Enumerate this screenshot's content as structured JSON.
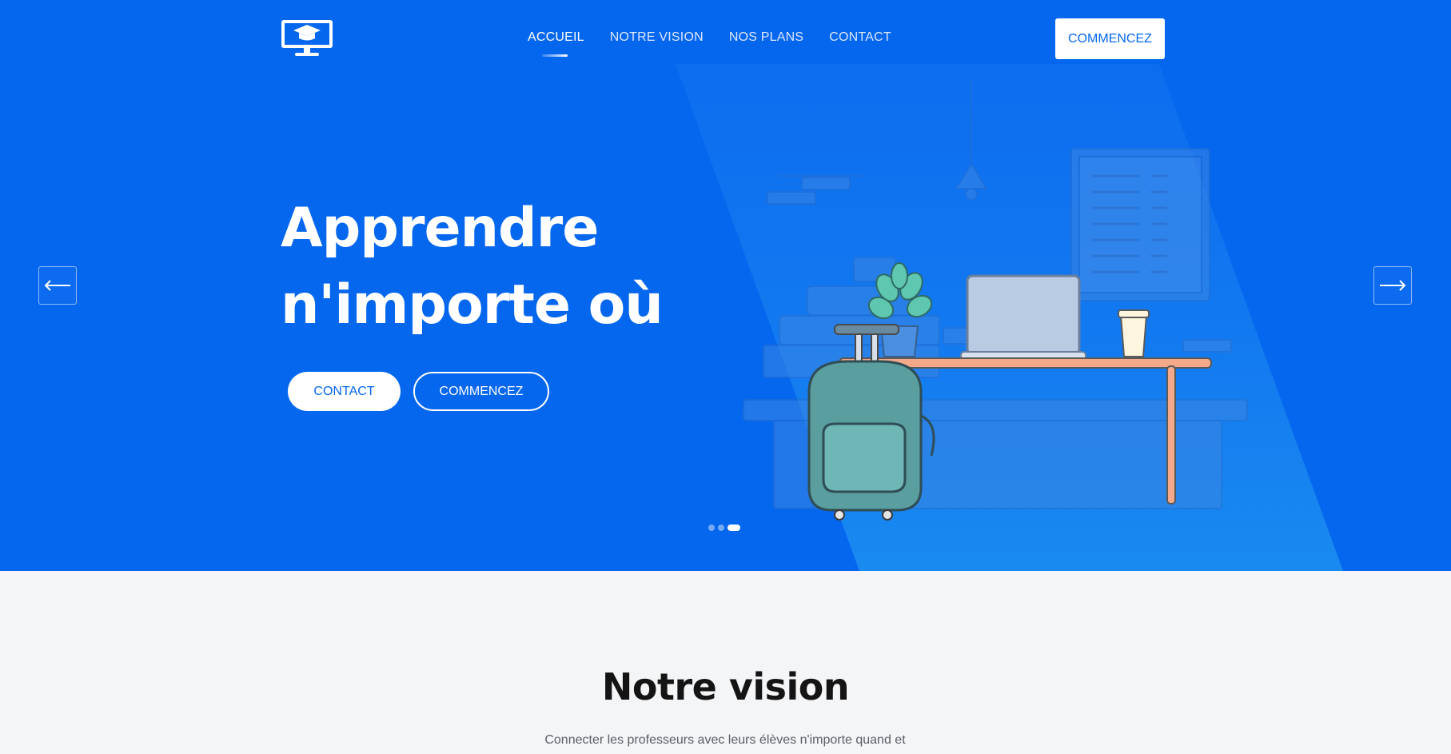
{
  "colors": {
    "hero_bg": "#0567ee",
    "beam": "#1a8cf0",
    "accent": "#0567ee",
    "white": "#ffffff",
    "section_bg": "#f4f5f7",
    "heading_dark": "#141414",
    "body_text": "#5a5f66"
  },
  "header": {
    "logo_icon": "monitor-graduation-cap-icon",
    "nav": [
      {
        "label": "ACCUEIL",
        "active": true
      },
      {
        "label": "NOTRE VISION",
        "active": false
      },
      {
        "label": "NOS PLANS",
        "active": false
      },
      {
        "label": "CONTACT",
        "active": false
      }
    ],
    "cta_label": "COMMENCEZ"
  },
  "hero": {
    "title_line1": "Apprendre",
    "title_line2": "n'importe où",
    "contact_button": "CONTACT",
    "start_button": "COMMENCEZ",
    "prev_icon": "arrow-left-icon",
    "next_icon": "arrow-right-icon",
    "slides_total": 3,
    "active_slide": 3
  },
  "vision": {
    "title": "Notre vision",
    "text": "Connecter les professeurs avec leurs élèves n'importe quand et"
  }
}
